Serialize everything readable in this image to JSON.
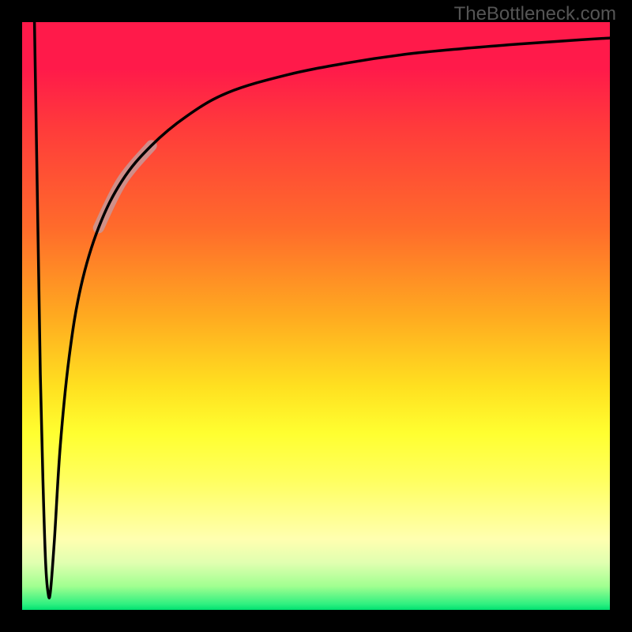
{
  "watermark": "TheBottleneck.com",
  "chart_data": {
    "type": "line",
    "title": "",
    "xlabel": "",
    "ylabel": "",
    "xlim": [
      0,
      100
    ],
    "ylim": [
      0,
      100
    ],
    "gradient_stops": [
      {
        "pos": 0,
        "color": "#ff1a4a"
      },
      {
        "pos": 8,
        "color": "#ff1a4a"
      },
      {
        "pos": 18,
        "color": "#ff3b3b"
      },
      {
        "pos": 35,
        "color": "#ff6b2b"
      },
      {
        "pos": 50,
        "color": "#ffaa20"
      },
      {
        "pos": 62,
        "color": "#ffe020"
      },
      {
        "pos": 70,
        "color": "#ffff30"
      },
      {
        "pos": 78,
        "color": "#ffff60"
      },
      {
        "pos": 84,
        "color": "#ffff90"
      },
      {
        "pos": 88,
        "color": "#ffffb0"
      },
      {
        "pos": 92,
        "color": "#e0ffb0"
      },
      {
        "pos": 96,
        "color": "#a0ff90"
      },
      {
        "pos": 99,
        "color": "#30f080"
      },
      {
        "pos": 100,
        "color": "#00e070"
      }
    ],
    "series": [
      {
        "name": "bottleneck-curve",
        "points": [
          {
            "x": 2.1,
            "y": 100
          },
          {
            "x": 2.6,
            "y": 70
          },
          {
            "x": 3.1,
            "y": 40
          },
          {
            "x": 3.6,
            "y": 20
          },
          {
            "x": 4.0,
            "y": 8
          },
          {
            "x": 4.4,
            "y": 3
          },
          {
            "x": 4.8,
            "y": 3
          },
          {
            "x": 5.5,
            "y": 12
          },
          {
            "x": 6.5,
            "y": 28
          },
          {
            "x": 8.0,
            "y": 43
          },
          {
            "x": 10.0,
            "y": 55
          },
          {
            "x": 13.0,
            "y": 65
          },
          {
            "x": 17.0,
            "y": 73
          },
          {
            "x": 22.0,
            "y": 79
          },
          {
            "x": 28.0,
            "y": 84
          },
          {
            "x": 35.0,
            "y": 88
          },
          {
            "x": 45.0,
            "y": 91
          },
          {
            "x": 55.0,
            "y": 93
          },
          {
            "x": 65.0,
            "y": 94.5
          },
          {
            "x": 75.0,
            "y": 95.5
          },
          {
            "x": 85.0,
            "y": 96.3
          },
          {
            "x": 95.0,
            "y": 97
          },
          {
            "x": 100.0,
            "y": 97.3
          }
        ],
        "highlight_range": {
          "x_start": 14,
          "x_end": 22
        }
      }
    ]
  }
}
